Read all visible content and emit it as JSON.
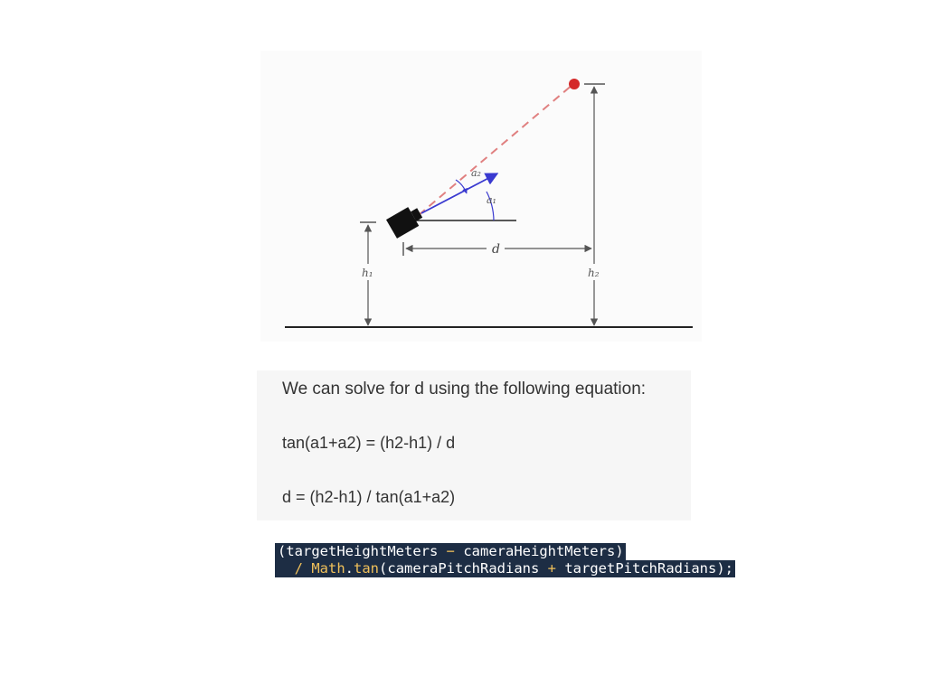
{
  "diagram": {
    "labels": {
      "a2": "a₂",
      "a1": "a₁",
      "d": "d",
      "h1": "h₁",
      "h2": "h₂"
    },
    "colors": {
      "sight_line": "#e08080",
      "target": "#d42a2a",
      "pitch_vector": "#3a3ad0",
      "structure": "#222222",
      "dimension": "#666666"
    }
  },
  "equations": {
    "intro": "We can solve for d using the following equation:",
    "tan_relation": "tan(a1+a2) = (h2-h1) / d",
    "d_solution": "d = (h2-h1) / tan(a1+a2)"
  },
  "code": {
    "line1": {
      "open_paren": "(",
      "target_height": "targetHeightMeters",
      "minus": " − ",
      "camera_height": "cameraHeightMeters",
      "close_paren": ")"
    },
    "line2": {
      "indent": "  ",
      "divide": "/ ",
      "math_class": "Math",
      "dot": ".",
      "tan_method": "tan",
      "open_paren": "(",
      "camera_pitch": "cameraPitchRadians",
      "plus": " + ",
      "target_pitch": "targetPitchRadians",
      "close_end": ");"
    }
  }
}
